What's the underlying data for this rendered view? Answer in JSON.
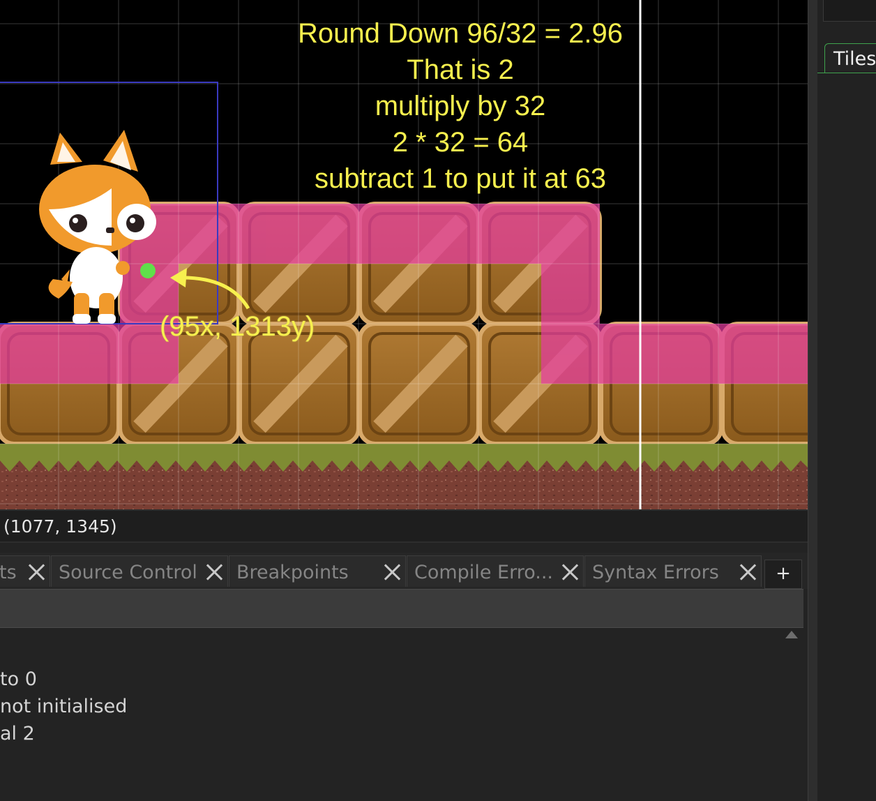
{
  "annotation": {
    "lines": [
      "Round Down 96/32 = 2.96",
      "That is 2",
      "multiply by 32",
      "2 * 32 = 64",
      "subtract 1 to put it at 63"
    ],
    "point_label": "(95x, 1313y)"
  },
  "status_bar": {
    "cursor_position": "(1077, 1345)"
  },
  "output_tabs": [
    {
      "label": "ts",
      "close_icon": "close-icon"
    },
    {
      "label": "Source Control",
      "close_icon": "close-icon"
    },
    {
      "label": "Breakpoints",
      "close_icon": "close-icon"
    },
    {
      "label": "Compile Erro...",
      "close_icon": "close-icon"
    },
    {
      "label": "Syntax Errors",
      "close_icon": "close-icon"
    }
  ],
  "add_tab_label": "+",
  "output": {
    "lines": [
      " to 0",
      "not initialised",
      "al 2"
    ]
  },
  "right_panel": {
    "tab_label": "Tiles"
  },
  "colors": {
    "annotation_text": "#f7f04e",
    "marker_point": "#5fe04a",
    "collision_overlay": "#e43ca0",
    "selection_box": "#3a3ac0",
    "active_tab_accent": "#3fa34d"
  }
}
